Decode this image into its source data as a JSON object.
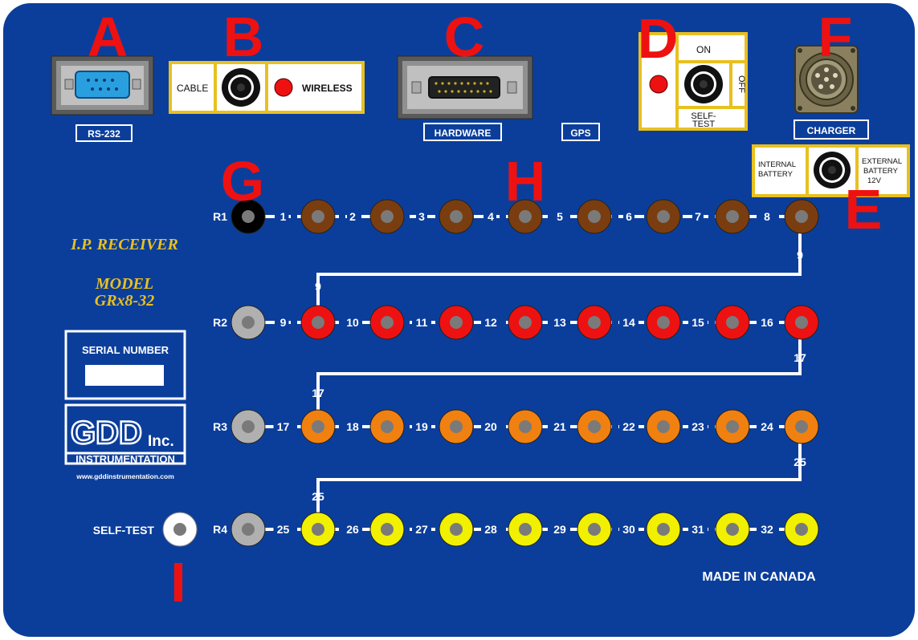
{
  "panel": {
    "title": "I.P. RECEIVER",
    "model_label": "MODEL",
    "model": "GRx8-32",
    "serial_label": "SERIAL NUMBER",
    "logo_gdd": "GDD",
    "logo_inc": "Inc.",
    "logo_sub": "INSTRUMENTATION",
    "website": "www.gddinstrumentation.com",
    "made_in": "MADE IN CANADA"
  },
  "markers": {
    "a": "A",
    "b": "B",
    "c": "C",
    "d": "D",
    "e": "E",
    "f": "F",
    "g": "G",
    "h": "H",
    "i": "I"
  },
  "connectors": {
    "rs232": "RS-232",
    "hardware": "HARDWARE",
    "gps": "GPS",
    "charger": "CHARGER",
    "cable": "CABLE",
    "wireless": "WIRELESS",
    "on": "ON",
    "off": "OFF",
    "self_test_1": "SELF-",
    "self_test_2": "TEST",
    "internal_1": "INTERNAL",
    "internal_2": "BATTERY",
    "external_1": "EXTERNAL",
    "external_2": "BATTERY",
    "external_3": "12V"
  },
  "rows": [
    {
      "ref": "R1",
      "ref_color": "#000000",
      "jack_color": "#7a3d10",
      "labels": [
        "1",
        "2",
        "3",
        "4",
        "5",
        "6",
        "7",
        "8"
      ]
    },
    {
      "ref": "R2",
      "ref_color": "#b0b0b0",
      "jack_color": "#ee1111",
      "labels": [
        "9",
        "10",
        "11",
        "12",
        "13",
        "14",
        "15",
        "16"
      ]
    },
    {
      "ref": "R3",
      "ref_color": "#b0b0b0",
      "jack_color": "#f08010",
      "labels": [
        "17",
        "18",
        "19",
        "20",
        "21",
        "22",
        "23",
        "24"
      ]
    },
    {
      "ref": "R4",
      "ref_color": "#b0b0b0",
      "jack_color": "#f0f000",
      "labels": [
        "25",
        "26",
        "27",
        "28",
        "29",
        "30",
        "31",
        "32"
      ]
    }
  ],
  "links": [
    {
      "top": "9",
      "bottom": "9"
    },
    {
      "top": "17",
      "bottom": "17"
    },
    {
      "top": "25",
      "bottom": "25"
    }
  ],
  "self_test_jack": {
    "label": "SELF-TEST",
    "color": "#ffffff"
  },
  "colors": {
    "panel_bg": "#0b3e9b",
    "box_border": "#e8c020",
    "led": "#ee1111",
    "marker": "#ee1111",
    "connector_metal": "#8a8060"
  }
}
